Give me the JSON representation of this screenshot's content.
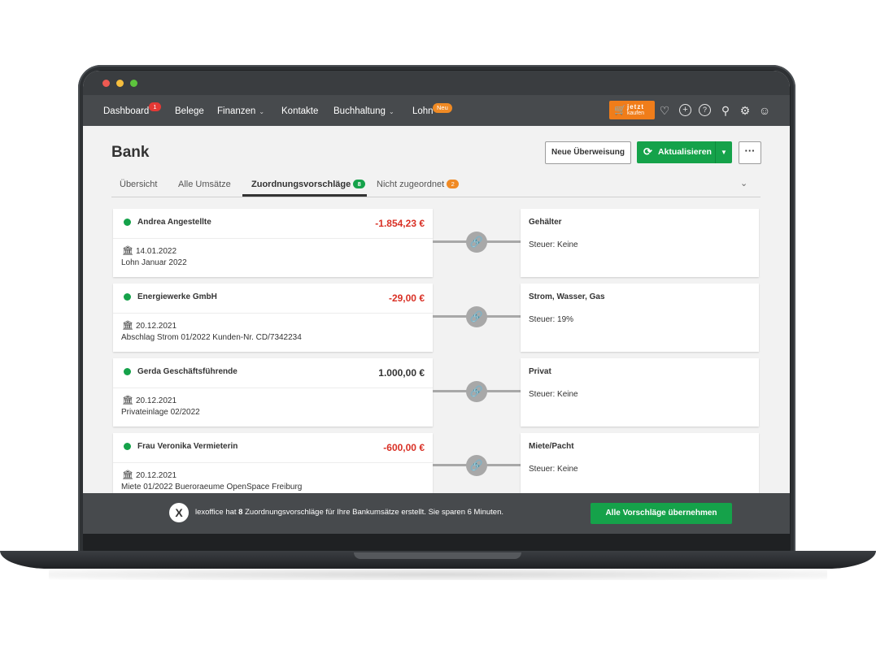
{
  "nav": {
    "items": [
      {
        "label": "Dashboard",
        "badge": "1"
      },
      {
        "label": "Belege"
      },
      {
        "label": "Finanzen"
      },
      {
        "label": "Kontakte"
      },
      {
        "label": "Buchhaltung"
      },
      {
        "label": "Lohn",
        "badge": "Neu"
      }
    ],
    "buy_line1": "jetzt",
    "buy_line2": "kaufen",
    "icons": [
      "heart-icon",
      "plus-circle-icon",
      "help-icon",
      "search-icon",
      "gear-icon",
      "user-icon"
    ]
  },
  "page": {
    "title": "Bank",
    "new_transfer": "Neue Überweisung",
    "refresh": "Aktualisieren"
  },
  "tabs": [
    {
      "label": "Übersicht"
    },
    {
      "label": "Alle Umsätze"
    },
    {
      "label": "Zuordnungsvorschläge",
      "badge": "8"
    },
    {
      "label": "Nicht zugeordnet",
      "badge": "2"
    }
  ],
  "suggestions": [
    {
      "name": "Andrea Angestellte",
      "amount": "-1.854,23 €",
      "date": "14.01.2022",
      "desc": "Lohn Januar 2022",
      "category": "Gehälter",
      "tax": "Steuer: Keine"
    },
    {
      "name": "Energiewerke GmbH",
      "amount": "-29,00 €",
      "date": "20.12.2021",
      "desc": "Abschlag Strom 01/2022 Kunden-Nr. CD/7342234",
      "category": "Strom, Wasser, Gas",
      "tax": "Steuer: 19%"
    },
    {
      "name": "Gerda Geschäftsführende",
      "amount": "1.000,00 €",
      "date": "20.12.2021",
      "desc": "Privateinlage 02/2022",
      "category": "Privat",
      "tax": "Steuer: Keine"
    },
    {
      "name": "Frau Veronika Vermieterin",
      "amount": "-600,00 €",
      "date": "20.12.2021",
      "desc": "Miete 01/2022 Bueroraeume OpenSpace Freiburg",
      "category": "Miete/Pacht",
      "tax": "Steuer: Keine"
    }
  ],
  "bottom": {
    "text_pre": "lexoffice hat ",
    "count": "8",
    "text_post": " Zuordnungsvorschläge für Ihre Bankumsätze erstellt. Sie sparen 6 Minuten.",
    "accept_all": "Alle Vorschläge übernehmen"
  },
  "colors": {
    "accent": "#15a24a",
    "negative": "#d93025",
    "buy": "#f07d1a"
  }
}
